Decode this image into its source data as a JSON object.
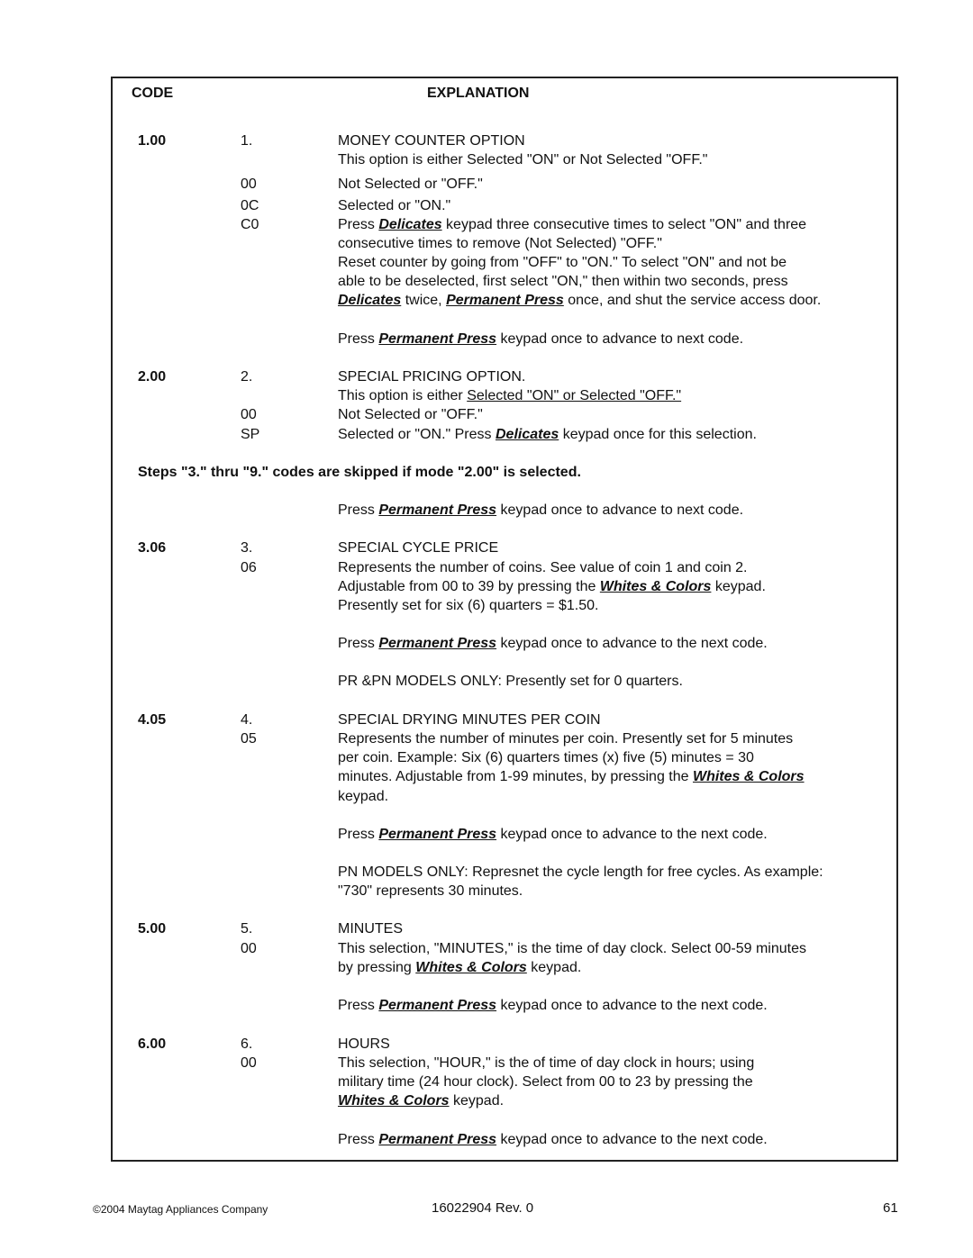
{
  "header": {
    "code": "CODE",
    "explanation": "EXPLANATION"
  },
  "keypads": {
    "delicates": "Delicates",
    "permanent_press": "Permanent Press",
    "whites_colors": "Whites & Colors"
  },
  "s1": {
    "code": "1.00",
    "step": "1.",
    "title": "MONEY COUNTER OPTION",
    "desc": "This option is either Selected \"ON\" or Not Selected \"OFF.\"",
    "v1": "00",
    "v1_text": "Not Selected or \"OFF.\"",
    "v2": "0C",
    "v2_text": "Selected or \"ON.\"",
    "v3": "C0",
    "l1_pre": "Press ",
    "l1_post": " keypad three consecutive times to select \"ON\" and three",
    "l2": "consecutive times to remove (Not Selected) \"OFF.\"",
    "l3": "Reset counter by going from \"OFF\" to \"ON.\"  To select \"ON\" and not be",
    "l4": "able to be deselected, first select \"ON,\" then within two seconds, press",
    "l5_mid": " twice, ",
    "l5_post": " once, and shut the service access door.",
    "adv_pre": "Press ",
    "adv_post": " keypad once to advance to next code."
  },
  "s2": {
    "code": "2.00",
    "step": "2.",
    "title": "SPECIAL PRICING OPTION.",
    "desc_pre": "This option is either ",
    "desc_u": "Selected \"ON\" or Selected \"OFF.\"",
    "v1": "00",
    "v1_text": "Not Selected or \"OFF.\"",
    "v2": "SP",
    "v2_pre": "Selected or \"ON.\"  Press ",
    "v2_post": " keypad once for this selection.",
    "note": "Steps \"3.\" thru \"9.\" codes are skipped if mode \"2.00\" is selected.",
    "adv_pre": "Press ",
    "adv_post": " keypad once to advance to next code."
  },
  "s3": {
    "code": "3.06",
    "step": "3.",
    "title": "SPECIAL CYCLE PRICE",
    "v1": "06",
    "l1": "Represents the number of coins.  See value of coin 1 and coin 2.",
    "l2_pre": "Adjustable from 00 to 39 by pressing the ",
    "l2_post": " keypad.",
    "l3": "Presently set for six (6) quarters = $1.50.",
    "adv_pre": "Press ",
    "adv_post": " keypad once to advance to the next code.",
    "note": "PR &PN MODELS ONLY:  Presently set for 0 quarters."
  },
  "s4": {
    "code": "4.05",
    "step": "4.",
    "title": "SPECIAL DRYING MINUTES PER COIN",
    "v1": "05",
    "l1": "Represents the number of minutes per coin.  Presently set for 5 minutes",
    "l2": "per coin.  Example:  Six (6) quarters times (x) five (5) minutes = 30",
    "l3_pre": "minutes.  Adjustable from 1-99 minutes, by pressing the ",
    "l4": "keypad.",
    "adv_pre": "Press ",
    "adv_post": " keypad once to advance to the next code.",
    "note1": "PN MODELS ONLY:  Represnet the cycle length for free cycles.  As example:",
    "note2": "\"730\" represents 30 minutes."
  },
  "s5": {
    "code": "5.00",
    "step": "5.",
    "title": "MINUTES",
    "v1": "00",
    "l1": "This selection, \"MINUTES,\" is the time of day clock.  Select 00-59 minutes",
    "l2_pre": "by pressing ",
    "l2_post": " keypad.",
    "adv_pre": "Press ",
    "adv_post": " keypad once to advance to the next code."
  },
  "s6": {
    "code": "6.00",
    "step": "6.",
    "title": "HOURS",
    "v1": "00",
    "l1": "This selection, \"HOUR,\" is the of time of day clock in hours; using",
    "l2": "military time (24 hour clock).  Select from 00 to 23 by pressing the",
    "l3_post": " keypad.",
    "adv_pre": "Press ",
    "adv_post": " keypad once to advance to the next code."
  },
  "footer": {
    "copyright": "©2004 Maytag Appliances Company",
    "doc": "16022904  Rev. 0",
    "page": "61"
  }
}
